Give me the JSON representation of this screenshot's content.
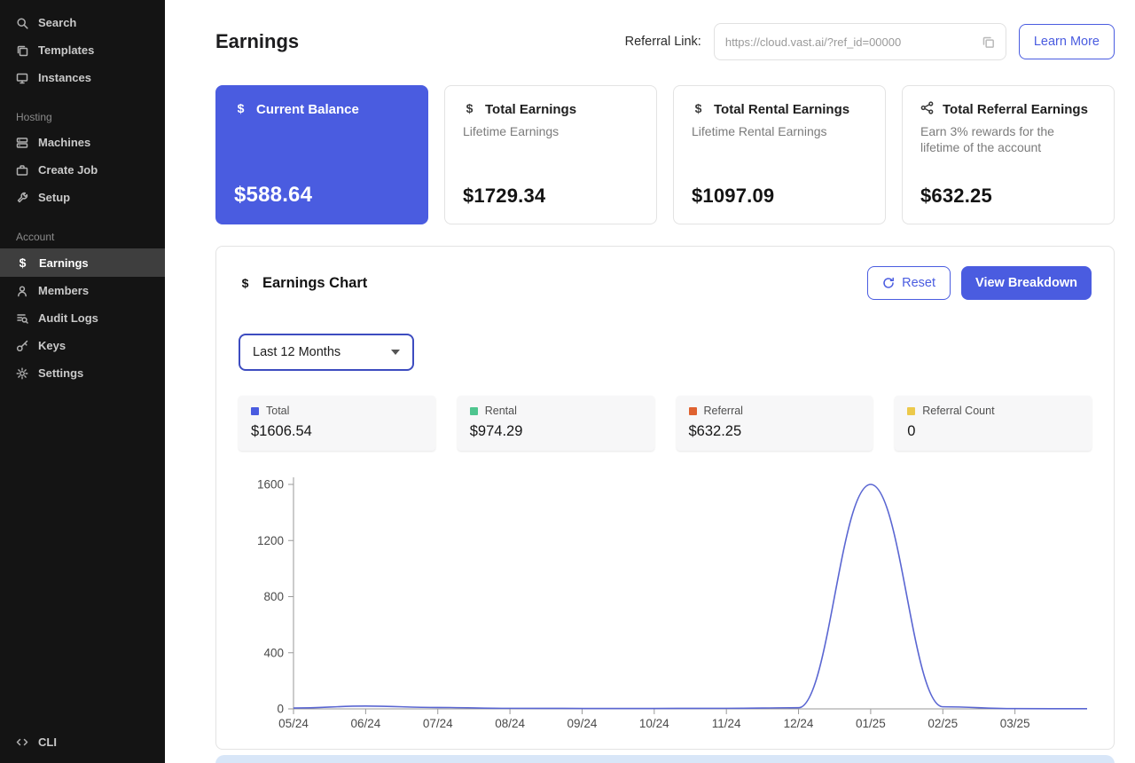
{
  "colors": {
    "accent": "#4a5ce0",
    "line": "#5a66d2",
    "rental": "#4fc58f",
    "referral": "#df6230",
    "referral_count": "#ecc94b",
    "sidebar_bg": "#141414"
  },
  "sidebar": {
    "groups": [
      {
        "label": "",
        "items": [
          {
            "label": "Search"
          },
          {
            "label": "Templates"
          },
          {
            "label": "Instances"
          }
        ]
      },
      {
        "label": "Hosting",
        "items": [
          {
            "label": "Machines"
          },
          {
            "label": "Create Job"
          },
          {
            "label": "Setup"
          }
        ]
      },
      {
        "label": "Account",
        "items": [
          {
            "label": "Earnings",
            "active": true
          },
          {
            "label": "Members"
          },
          {
            "label": "Audit Logs"
          },
          {
            "label": "Keys"
          },
          {
            "label": "Settings"
          }
        ]
      }
    ],
    "footer": {
      "label": "CLI"
    }
  },
  "header": {
    "title": "Earnings",
    "referral_label": "Referral Link:",
    "referral_url": "https://cloud.vast.ai/?ref_id=00000",
    "learn_more": "Learn More"
  },
  "cards": [
    {
      "title": "Current Balance",
      "amount": "$588.64"
    },
    {
      "title": "Total Earnings",
      "subtitle": "Lifetime Earnings",
      "amount": "$1729.34"
    },
    {
      "title": "Total Rental Earnings",
      "subtitle": "Lifetime Rental Earnings",
      "amount": "$1097.09"
    },
    {
      "title": "Total Referral Earnings",
      "subtitle": "Earn 3% rewards for the lifetime of the account",
      "amount": "$632.25"
    }
  ],
  "panel": {
    "title": "Earnings Chart",
    "reset": "Reset",
    "view_breakdown": "View Breakdown",
    "range_select": "Last 12 Months",
    "stats": [
      {
        "label": "Total",
        "value": "$1606.54",
        "color": "#4a5ce0"
      },
      {
        "label": "Rental",
        "value": "$974.29",
        "color": "#4fc58f"
      },
      {
        "label": "Referral",
        "value": "$632.25",
        "color": "#df6230"
      },
      {
        "label": "Referral Count",
        "value": "0",
        "color": "#ecc94b"
      }
    ]
  },
  "chart_data": {
    "type": "line",
    "title": "Earnings Chart",
    "x_labels": [
      "05/24",
      "06/24",
      "07/24",
      "08/24",
      "09/24",
      "10/24",
      "11/24",
      "12/24",
      "01/25",
      "02/25",
      "03/25",
      ""
    ],
    "series": [
      {
        "name": "Total",
        "color": "#5a66d2",
        "values": [
          6,
          20,
          10,
          4,
          3,
          3,
          4,
          8,
          1600,
          15,
          2,
          1
        ]
      }
    ],
    "ylim": [
      0,
      1600
    ],
    "yticks": [
      0,
      400,
      800,
      1200,
      1600
    ],
    "xlabel": "",
    "ylabel": "",
    "grid": false,
    "legend_position": "none"
  }
}
